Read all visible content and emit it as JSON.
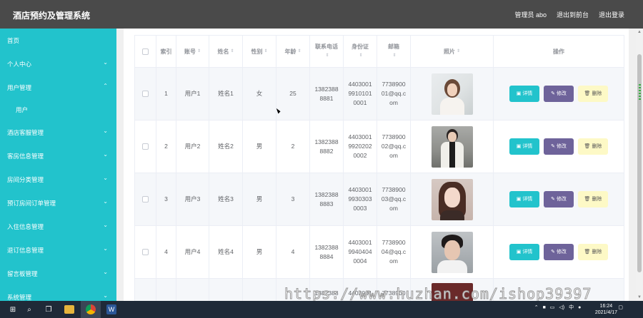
{
  "app": {
    "title": "酒店预约及管理系统"
  },
  "header": {
    "admin_label": "管理员 abo",
    "front_label": "退出到前台",
    "logout_label": "退出登录"
  },
  "sidebar": {
    "items": [
      {
        "label": "首页",
        "chevron": ""
      },
      {
        "label": "个人中心",
        "chevron": "⌄"
      },
      {
        "label": "用户管理",
        "chevron": "⌃"
      },
      {
        "label": "用户",
        "chevron": "",
        "sub": true
      },
      {
        "label": "酒店客服管理",
        "chevron": "⌄"
      },
      {
        "label": "客房信息管理",
        "chevron": "⌄"
      },
      {
        "label": "房间分类管理",
        "chevron": "⌄"
      },
      {
        "label": "预订房间订单管理",
        "chevron": "⌄"
      },
      {
        "label": "入住信息管理",
        "chevron": "⌄"
      },
      {
        "label": "退订信息管理",
        "chevron": "⌄"
      },
      {
        "label": "留言板管理",
        "chevron": "⌄"
      },
      {
        "label": "系统管理",
        "chevron": "⌄"
      }
    ]
  },
  "table": {
    "headers": {
      "index": "索引",
      "account": "账号",
      "name": "姓名",
      "gender": "性别",
      "age": "年龄",
      "phone": "联系电话",
      "id_card": "身份证",
      "email": "邮箱",
      "photo": "照片",
      "actions": "操作"
    },
    "rows": [
      {
        "index": "1",
        "account": "用户1",
        "name": "姓名1",
        "gender": "女",
        "age": "25",
        "phone": "13823888881",
        "id_card": "440300199101010001",
        "email": "773890001@qq.com"
      },
      {
        "index": "2",
        "account": "用户2",
        "name": "姓名2",
        "gender": "男",
        "age": "2",
        "phone": "13823888882",
        "id_card": "440300199202020002",
        "email": "773890002@qq.com"
      },
      {
        "index": "3",
        "account": "用户3",
        "name": "姓名3",
        "gender": "男",
        "age": "3",
        "phone": "13823888883",
        "id_card": "440300199303030003",
        "email": "773890003@qq.com"
      },
      {
        "index": "4",
        "account": "用户4",
        "name": "姓名4",
        "gender": "男",
        "age": "4",
        "phone": "13823888884",
        "id_card": "440300199404040004",
        "email": "773890004@qq.com"
      }
    ],
    "buttons": {
      "detail": "详情",
      "edit": "修改",
      "delete": "删除"
    },
    "partial_row": {
      "phone": "1382388",
      "id_card": "4403001",
      "email": "7738900"
    }
  },
  "watermark": "https://www.huzhan.com/ishop39397",
  "taskbar": {
    "time": "16:24",
    "date": "2021/4/17",
    "ime": "中"
  },
  "colors": {
    "accent": "#22c3cc",
    "topbar": "#4a4a4a",
    "edit": "#6e639a",
    "delete": "#fdf9c6",
    "taskbar": "#1f2a38"
  }
}
